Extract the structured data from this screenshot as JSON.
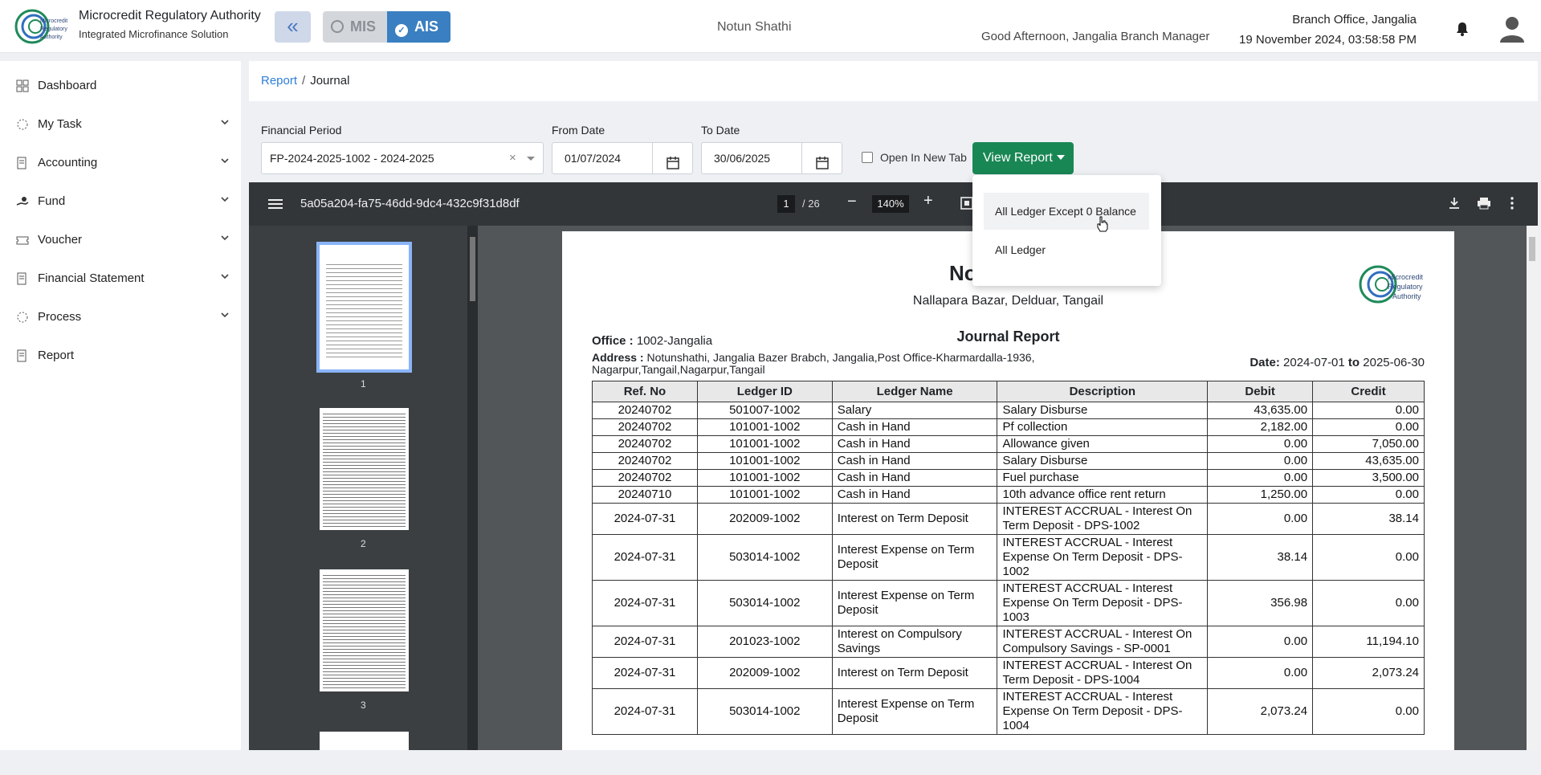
{
  "header": {
    "brand_title": "Microcredit Regulatory Authority",
    "brand_subtitle": "Integrated Microfinance Solution",
    "logo_text": "Microcredit Regulatory Authority",
    "mis_label": "MIS",
    "ais_label": "AIS",
    "org_name": "Notun Shathi",
    "greeting": "Good Afternoon, Jangalia Branch Manager",
    "branch": "Branch Office, Jangalia",
    "datetime": "19 November 2024, 03:58:58 PM"
  },
  "sidebar": {
    "items": [
      {
        "label": "Dashboard"
      },
      {
        "label": "My Task"
      },
      {
        "label": "Accounting"
      },
      {
        "label": "Fund"
      },
      {
        "label": "Voucher"
      },
      {
        "label": "Financial Statement"
      },
      {
        "label": "Process"
      },
      {
        "label": "Report"
      }
    ]
  },
  "breadcrumb": {
    "parent": "Report",
    "separator": "/",
    "current": "Journal"
  },
  "filters": {
    "period_label": "Financial Period",
    "period_value": "FP-2024-2025-1002 - 2024-2025",
    "from_label": "From Date",
    "from_value": "01/07/2024",
    "to_label": "To Date",
    "to_value": "30/06/2025",
    "new_tab_label": "Open In New Tab",
    "view_report_label": "View Report"
  },
  "dropdown": {
    "items": [
      "All Ledger Except 0 Balance",
      "All Ledger"
    ]
  },
  "pdf": {
    "file_id": "5a05a204-fa75-46dd-9dc4-432c9f31d8df",
    "page_current": "1",
    "page_total": "/ 26",
    "zoom": "140%",
    "thumbs": [
      "1",
      "2",
      "3"
    ]
  },
  "report": {
    "org_partial": "No",
    "address_line": "Nallapara Bazar, Delduar, Tangail",
    "title": "Journal Report",
    "office_label": "Office :",
    "office_value": "1002-Jangalia",
    "address_label": "Address :",
    "address_value": "Notunshathi, Jangalia Bazer Brabch, Jangalia,Post Office-Kharmardalla-1936, Nagarpur,Tangail,Nagarpur,Tangail",
    "date_label": "Date:",
    "date_from": "2024-07-01",
    "date_to_word": "to",
    "date_to": "2025-06-30",
    "columns": [
      "Ref. No",
      "Ledger ID",
      "Ledger Name",
      "Description",
      "Debit",
      "Credit"
    ],
    "rows": [
      [
        "20240702",
        "501007-1002",
        "Salary",
        "Salary Disburse",
        "43,635.00",
        "0.00"
      ],
      [
        "20240702",
        "101001-1002",
        "Cash in Hand",
        "Pf collection",
        "2,182.00",
        "0.00"
      ],
      [
        "20240702",
        "101001-1002",
        "Cash in Hand",
        "Allowance given",
        "0.00",
        "7,050.00"
      ],
      [
        "20240702",
        "101001-1002",
        "Cash in Hand",
        "Salary Disburse",
        "0.00",
        "43,635.00"
      ],
      [
        "20240702",
        "101001-1002",
        "Cash in Hand",
        "Fuel purchase",
        "0.00",
        "3,500.00"
      ],
      [
        "20240710",
        "101001-1002",
        "Cash in Hand",
        "10th advance office rent return",
        "1,250.00",
        "0.00"
      ],
      [
        "2024-07-31",
        "202009-1002",
        "Interest on Term Deposit",
        "INTEREST ACCRUAL - Interest On Term Deposit - DPS-1002",
        "0.00",
        "38.14"
      ],
      [
        "2024-07-31",
        "503014-1002",
        "Interest Expense on Term Deposit",
        "INTEREST ACCRUAL - Interest Expense On Term Deposit - DPS-1002",
        "38.14",
        "0.00"
      ],
      [
        "2024-07-31",
        "503014-1002",
        "Interest Expense on Term Deposit",
        "INTEREST ACCRUAL - Interest Expense On Term Deposit - DPS-1003",
        "356.98",
        "0.00"
      ],
      [
        "2024-07-31",
        "201023-1002",
        "Interest on Compulsory Savings",
        "INTEREST ACCRUAL - Interest On Compulsory Savings - SP-0001",
        "0.00",
        "11,194.10"
      ],
      [
        "2024-07-31",
        "202009-1002",
        "Interest on Term Deposit",
        "INTEREST ACCRUAL - Interest On Term Deposit - DPS-1004",
        "0.00",
        "2,073.24"
      ],
      [
        "2024-07-31",
        "503014-1002",
        "Interest Expense on Term Deposit",
        "INTEREST ACCRUAL - Interest Expense On Term Deposit - DPS-1004",
        "2,073.24",
        "0.00"
      ]
    ]
  },
  "colors": {
    "accent": "#3a7fc1",
    "success": "#198754",
    "link": "#2f7ed8",
    "pdf_toolbar": "#323639"
  }
}
